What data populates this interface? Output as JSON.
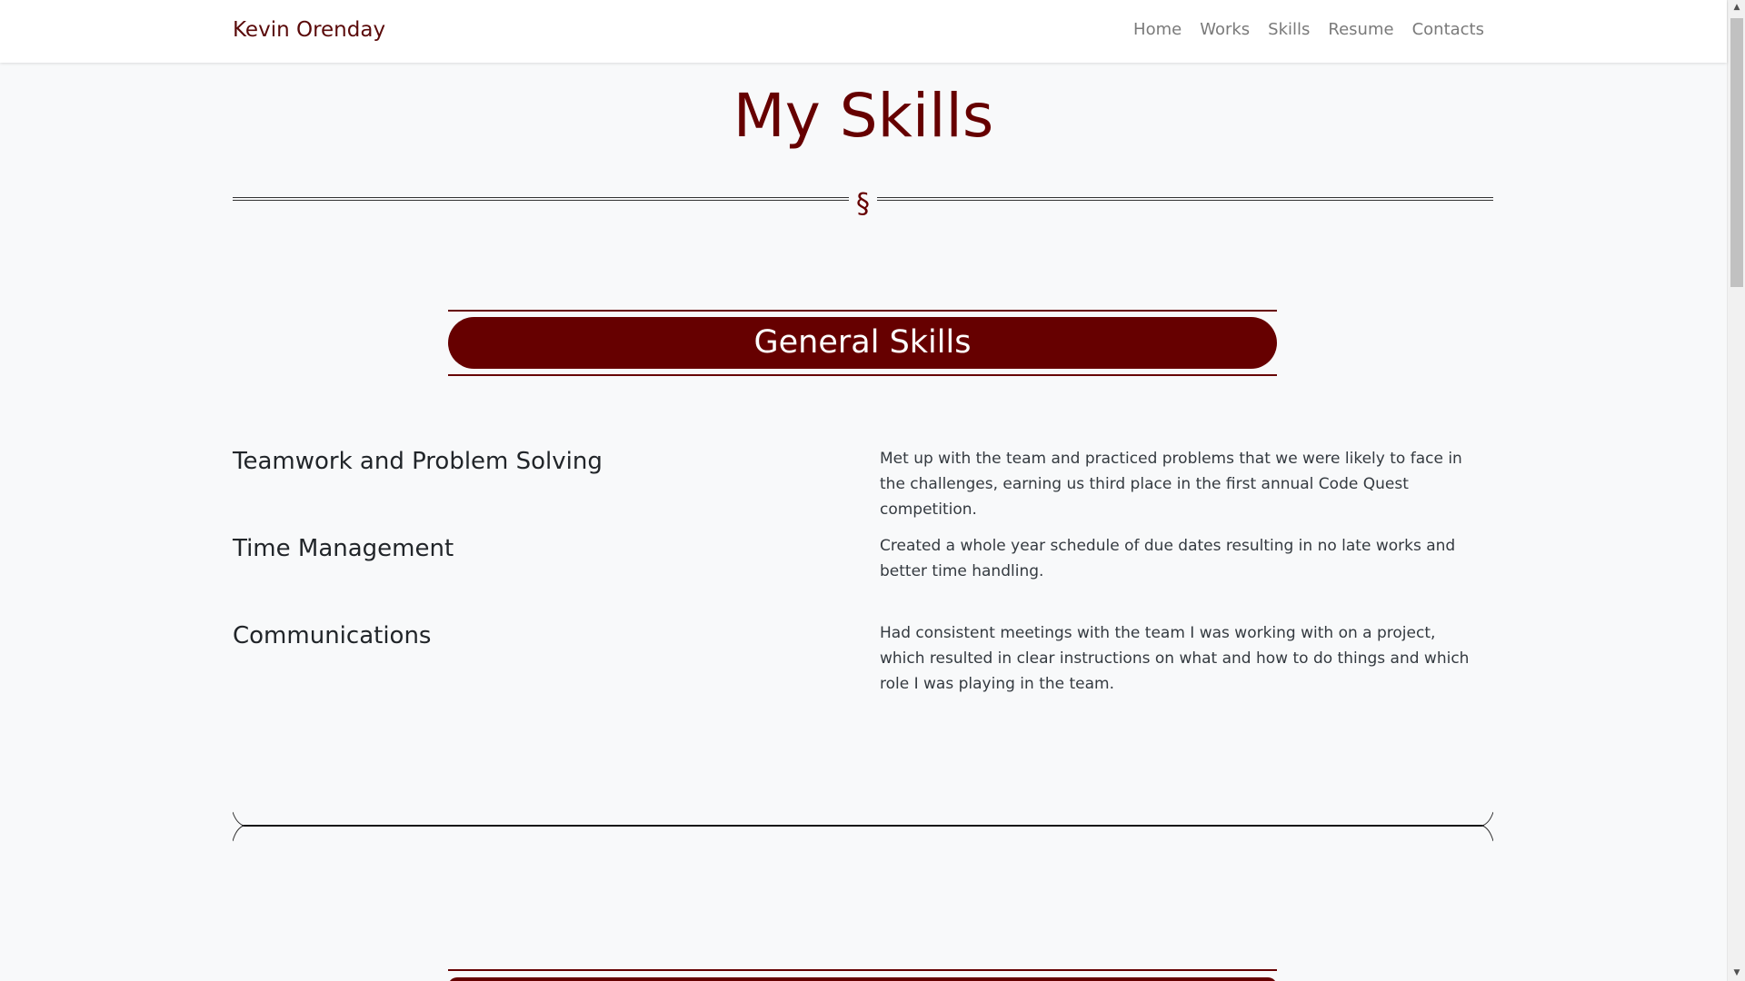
{
  "navbar": {
    "brand": "Kevin Orenday",
    "links": [
      "Home",
      "Works",
      "Skills",
      "Resume",
      "Contacts"
    ]
  },
  "page": {
    "title": "My Skills",
    "divider_symbol": "§"
  },
  "section": {
    "title": "General Skills",
    "skills": [
      {
        "name": "Teamwork and Problem Solving",
        "description": "Met up with the team and practiced problems that we were likely to face in the challenges, earning us third place in the first annual Code Quest competition."
      },
      {
        "name": "Time Management",
        "description": "Created a whole year schedule of due dates resulting in no late works and better time handling."
      },
      {
        "name": "Communications",
        "description": "Had consistent meetings with the team I was working with on a project, which resulted in clear instructions on what and how to do things and which role I was playing in the team."
      }
    ]
  },
  "theme": {
    "accent": "#660000",
    "background": "#f8f9fa",
    "nav_link": "#7a7a7a"
  },
  "icons": {
    "scroll_up": "▲",
    "scroll_down": "▼"
  }
}
